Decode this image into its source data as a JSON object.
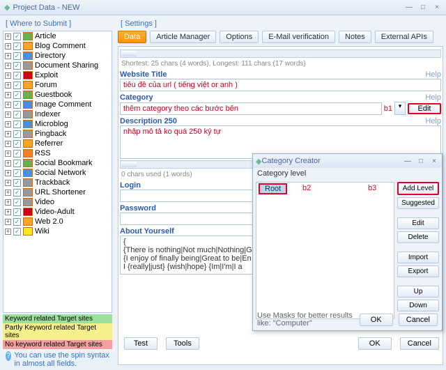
{
  "window": {
    "title": "Project Data - NEW"
  },
  "sidebar": {
    "group": "[ Where to Submit ]",
    "items": [
      {
        "label": "Article",
        "ic": "green"
      },
      {
        "label": "Blog Comment",
        "ic": "orange"
      },
      {
        "label": "Directory",
        "ic": "blue"
      },
      {
        "label": "Document Sharing",
        "ic": "gray"
      },
      {
        "label": "Exploit",
        "ic": "red"
      },
      {
        "label": "Forum",
        "ic": "orange"
      },
      {
        "label": "Guestbook",
        "ic": "green"
      },
      {
        "label": "Image Comment",
        "ic": "blue"
      },
      {
        "label": "Indexer",
        "ic": "gray"
      },
      {
        "label": "Microblog",
        "ic": "blue"
      },
      {
        "label": "Pingback",
        "ic": "gray"
      },
      {
        "label": "Referrer",
        "ic": "orange"
      },
      {
        "label": "RSS",
        "ic": "rss"
      },
      {
        "label": "Social Bookmark",
        "ic": "green"
      },
      {
        "label": "Social Network",
        "ic": "blue"
      },
      {
        "label": "Trackback",
        "ic": "gray"
      },
      {
        "label": "URL Shortener",
        "ic": "gray"
      },
      {
        "label": "Video",
        "ic": "gray"
      },
      {
        "label": "Video-Adult",
        "ic": "red"
      },
      {
        "label": "Web 2.0",
        "ic": "orange"
      },
      {
        "label": "Wiki",
        "ic": "yellow"
      }
    ],
    "kw": [
      "Keyword related Target sites",
      "Partly Keyword related Target sites",
      "No keyword related Target sites"
    ],
    "hint": "You can use the spin syntax in almost all fields."
  },
  "tabs": {
    "group": "[ Settings ]",
    "items": [
      "Data",
      "Article Manager",
      "Options",
      "E-Mail verification",
      "Notes",
      "External APIs"
    ]
  },
  "form": {
    "snippet_top": "…",
    "stats": "Shortest: 25 chars (4 words), Longest: 111 chars (17 words)",
    "website_title": {
      "label": "Website Title",
      "help": "Help",
      "value": "tiêu đề của url ( tiếng việt or anh )"
    },
    "category": {
      "label": "Category",
      "help": "Help",
      "value": "thêm category theo các bước bên",
      "b1": "b1",
      "edit": "Edit"
    },
    "desc": {
      "label": "Description 250",
      "help": "Help",
      "value": "nhập mô tả ko quá 250 ký tự"
    },
    "chars": "0 chars used (1 words)",
    "login": {
      "label": "Login",
      "value": ""
    },
    "password": {
      "label": "Password",
      "value": ""
    },
    "about": {
      "label": "About Yourself",
      "lines": [
        "{",
        "{There is nothing|Not much|Nothing|G",
        "{I enjoy of finally being|Great to be|En",
        "I {really|just} {wish|hope} {Im|I'm|I a"
      ]
    }
  },
  "buttons": {
    "test": "Test",
    "tools": "Tools",
    "ok": "OK",
    "cancel": "Cancel"
  },
  "popup": {
    "title": "Category Creator",
    "level_label": "Category level",
    "root": "Root",
    "b2": "b2",
    "b3": "b3",
    "side": [
      "Add Level",
      "Suggested",
      "Edit",
      "Delete",
      "Import",
      "Export",
      "Up",
      "Down"
    ],
    "masks": "Use Masks for better results\nlike: \"Computer\"",
    "ok": "OK",
    "cancel": "Cancel"
  }
}
